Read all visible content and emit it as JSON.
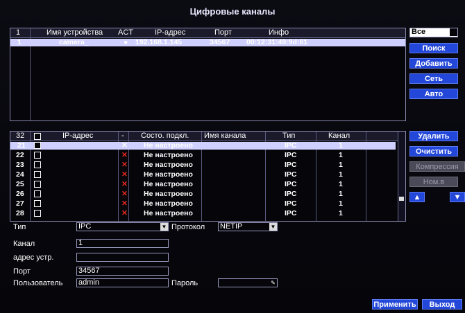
{
  "window": {
    "title": "Цифровые каналы"
  },
  "top_table": {
    "headers": {
      "num": "1",
      "name": "Имя устройства",
      "act": "ACT",
      "ip": "IP-адрес",
      "port": "Порт",
      "info": "Инфо"
    },
    "rows": [
      {
        "num": "1",
        "name": "camera_",
        "act": "●",
        "ip": "192.168.1.145",
        "port": "34567",
        "info": "00:12:31:49:9d:61"
      }
    ]
  },
  "right_top": {
    "select_value": "Все",
    "search": "Поиск",
    "add": "Добавить",
    "network": "Сеть",
    "auto": "Авто"
  },
  "bottom_table": {
    "headers": {
      "num": "32",
      "ip": "IP-адрес",
      "dot": "-",
      "state": "Состо. подкл.",
      "chname": "Имя канала",
      "type": "Тип",
      "channel": "Канал"
    },
    "rows": [
      {
        "num": "21",
        "x": "✕",
        "state": "Не настроено",
        "type": "IPC",
        "channel": "1"
      },
      {
        "num": "22",
        "x": "✕",
        "state": "Не настроено",
        "type": "IPC",
        "channel": "1"
      },
      {
        "num": "23",
        "x": "✕",
        "state": "Не настроено",
        "type": "IPC",
        "channel": "1"
      },
      {
        "num": "24",
        "x": "✕",
        "state": "Не настроено",
        "type": "IPC",
        "channel": "1"
      },
      {
        "num": "25",
        "x": "✕",
        "state": "Не настроено",
        "type": "IPC",
        "channel": "1"
      },
      {
        "num": "26",
        "x": "✕",
        "state": "Не настроено",
        "type": "IPC",
        "channel": "1"
      },
      {
        "num": "27",
        "x": "✕",
        "state": "Не настроено",
        "type": "IPC",
        "channel": "1"
      },
      {
        "num": "28",
        "x": "✕",
        "state": "Не настроено",
        "type": "IPC",
        "channel": "1"
      }
    ]
  },
  "right_bottom": {
    "delete": "Удалить",
    "clear": "Очистить",
    "compression": "Компрессия",
    "nom": "Ном.в",
    "up": "▲",
    "down": "▼"
  },
  "form": {
    "type_label": "Тип",
    "type_value": "IPC",
    "protocol_label": "Протокол",
    "protocol_value": "NETIP",
    "channel_label": "Канал",
    "channel_value": "1",
    "addr_label": "адрес устр.",
    "addr_value": "",
    "port_label": "Порт",
    "port_value": "34567",
    "user_label": "Пользователь",
    "user_value": "admin",
    "password_label": "Пароль",
    "password_value": ""
  },
  "footer": {
    "apply": "Применить",
    "exit": "Выход"
  }
}
